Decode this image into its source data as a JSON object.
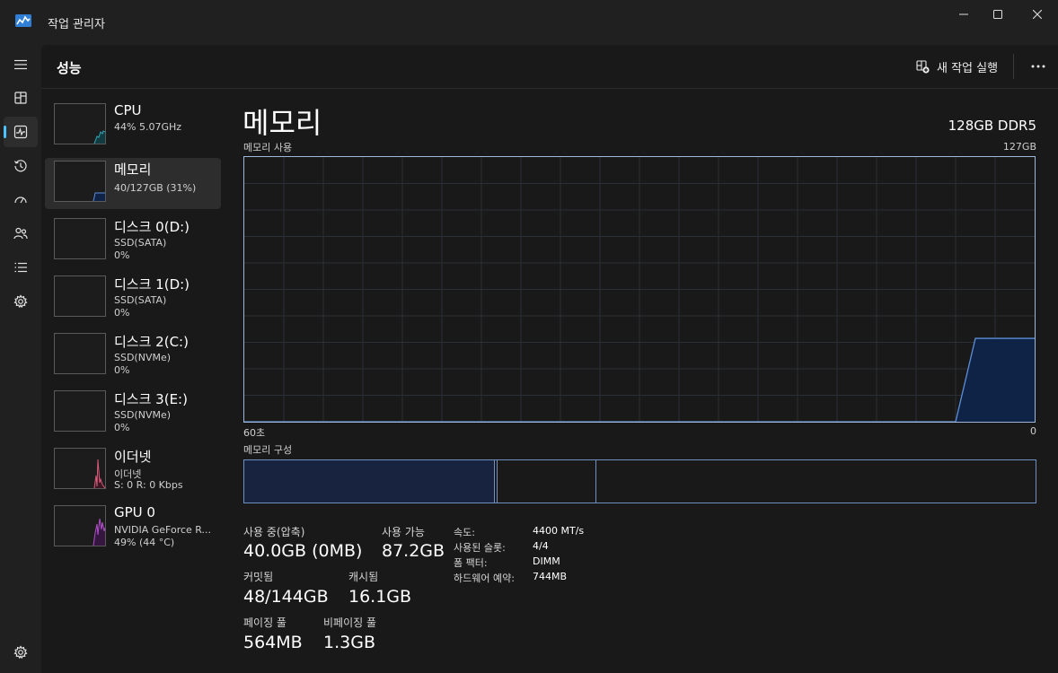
{
  "app": {
    "title": "작업 관리자"
  },
  "header": {
    "title": "성능",
    "run_task": "새 작업 실행"
  },
  "nav": [
    {
      "icon": "hamburger-icon"
    },
    {
      "icon": "processes-icon"
    },
    {
      "icon": "performance-icon",
      "active": true
    },
    {
      "icon": "app-history-icon"
    },
    {
      "icon": "startup-apps-icon"
    },
    {
      "icon": "users-icon"
    },
    {
      "icon": "details-icon"
    },
    {
      "icon": "services-icon"
    }
  ],
  "devices": [
    {
      "title": "CPU",
      "line1": "44% 5.07GHz",
      "line2": ""
    },
    {
      "title": "메모리",
      "line1": "40/127GB (31%)",
      "line2": ""
    },
    {
      "title": "디스크 0(D:)",
      "line1": "SSD(SATA)",
      "line2": "0%"
    },
    {
      "title": "디스크 1(D:)",
      "line1": "SSD(SATA)",
      "line2": "0%"
    },
    {
      "title": "디스크 2(C:)",
      "line1": "SSD(NVMe)",
      "line2": "0%"
    },
    {
      "title": "디스크 3(E:)",
      "line1": "SSD(NVMe)",
      "line2": "0%"
    },
    {
      "title": "이더넷",
      "line1": "이더넷",
      "line2": "S: 0 R: 0 Kbps"
    },
    {
      "title": "GPU 0",
      "line1": "NVIDIA GeForce R...",
      "line2": "49% (44 °C)"
    }
  ],
  "main": {
    "title": "메모리",
    "spec": "128GB DDR5",
    "usage_label": "메모리 사용",
    "usage_max": "127GB",
    "time_left": "60초",
    "time_right": "0",
    "composition_label": "메모리 구성"
  },
  "stats": {
    "in_use_label": "사용 중(압축)",
    "in_use_value": "40.0GB (0MB)",
    "available_label": "사용 가능",
    "available_value": "87.2GB",
    "committed_label": "커밋됨",
    "committed_value": "48/144GB",
    "cached_label": "캐시됨",
    "cached_value": "16.1GB",
    "paged_label": "페이징 풀",
    "paged_value": "564MB",
    "nonpaged_label": "비페이징 풀",
    "nonpaged_value": "1.3GB"
  },
  "specs": {
    "speed_key": "속도:",
    "speed_val": "4400 MT/s",
    "slots_key": "사용된 슬롯:",
    "slots_val": "4/4",
    "form_key": "폼 팩터:",
    "form_val": "DIMM",
    "reserved_key": "하드웨어 예약:",
    "reserved_val": "744MB"
  },
  "chart_data": {
    "type": "area",
    "title": "메모리 사용",
    "x": [
      60,
      6,
      4.5,
      0
    ],
    "values": [
      0,
      0,
      40,
      40
    ],
    "xlim": [
      60,
      0
    ],
    "ylim": [
      0,
      127
    ],
    "grid": true
  },
  "colors": {
    "accent": "#4cc2ff",
    "memory_line": "#5d8ed6",
    "memory_fill": "#0f2346",
    "cpu_line": "#2ea8b8",
    "ethernet_line": "#d65a78",
    "gpu_line": "#b04fc8"
  }
}
